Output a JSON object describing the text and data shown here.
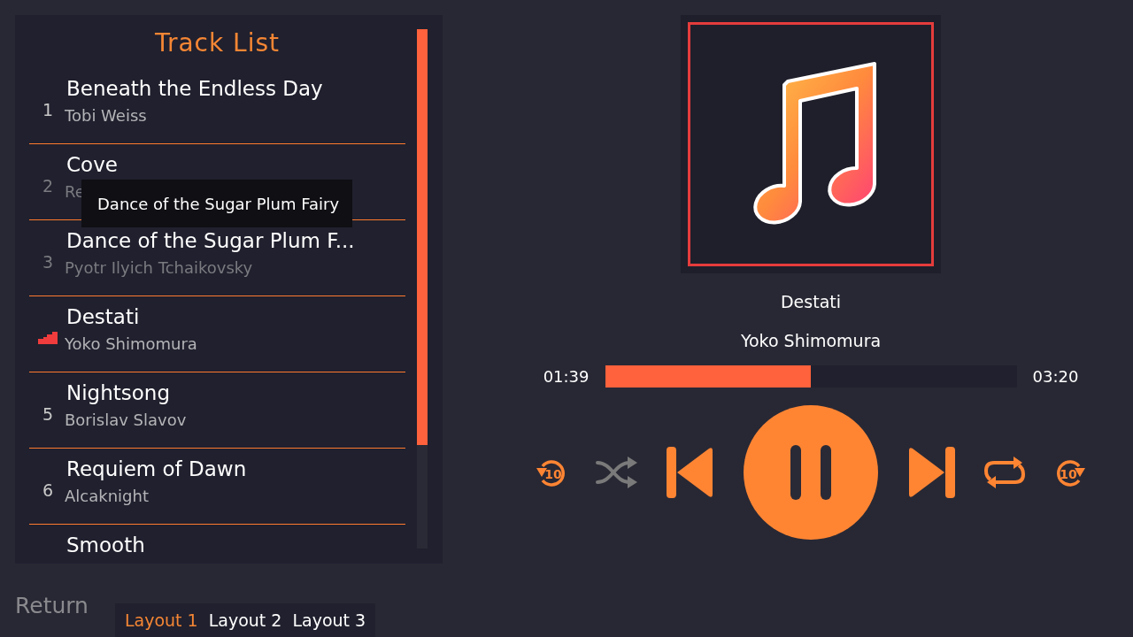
{
  "track_list": {
    "title": "Track List",
    "tracks": [
      {
        "number": "1",
        "title": "Beneath the Endless Day",
        "artist": "Tobi Weiss",
        "playing": false,
        "dimmed": false
      },
      {
        "number": "2",
        "title": "Cove",
        "artist": "Re",
        "playing": false,
        "dimmed": true
      },
      {
        "number": "3",
        "title": "Dance of the Sugar Plum F...",
        "artist": "Pyotr Ilyich Tchaikovsky",
        "playing": false,
        "dimmed": true
      },
      {
        "title": "Destati",
        "artist": "Yoko Shimomura",
        "playing": true,
        "dimmed": false
      },
      {
        "number": "5",
        "title": "Nightsong",
        "artist": "Borislav Slavov",
        "playing": false,
        "dimmed": false
      },
      {
        "number": "6",
        "title": "Requiem of Dawn",
        "artist": "Alcaknight",
        "playing": false,
        "dimmed": false
      },
      {
        "title": "Smooth"
      }
    ],
    "tooltip": "Dance of the Sugar Plum Fairy"
  },
  "now_playing": {
    "title": "Destati",
    "artist": "Yoko Shimomura",
    "elapsed": "01:39",
    "duration": "03:20",
    "level": 0.5,
    "playing": true,
    "shuffle": false,
    "repeat": true,
    "rewind_label": "10",
    "forward_label": "10"
  },
  "return_label": "Return",
  "layout_tabs": [
    {
      "label": "Layout 1",
      "selected": true
    },
    {
      "label": "Layout 2",
      "selected": false
    },
    {
      "label": "Layout 3",
      "selected": false
    }
  ]
}
